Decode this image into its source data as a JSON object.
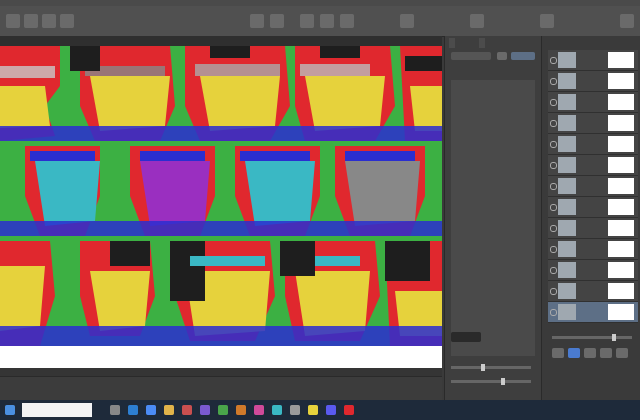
{
  "window": {
    "title": ""
  },
  "toolbar": {
    "items": [
      "",
      "",
      "",
      "",
      ""
    ]
  },
  "status": {
    "text": ""
  },
  "nav_panel": {
    "tabs": [
      "",
      ""
    ]
  },
  "layers": {
    "selected_index": 12,
    "count": 13
  },
  "taskbar": {
    "search_placeholder": "",
    "time": "",
    "date": ""
  },
  "colors": {
    "pattern_green": "#3cb043",
    "pattern_red": "#e0282e",
    "pattern_yellow": "#e6d23c",
    "pattern_blue": "#2a2ed0",
    "pattern_black": "#1e1e1e",
    "pattern_cyan": "#3ab8c4",
    "pattern_purple": "#9a2fc0",
    "selection": "#5d6f86"
  }
}
